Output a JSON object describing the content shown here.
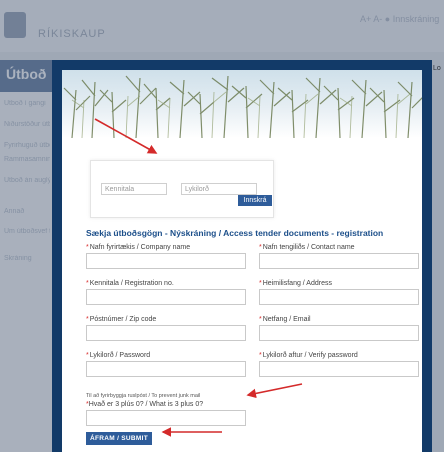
{
  "background": {
    "logo_text": "RÍKISKAUP",
    "sidebar_title": "Útboð",
    "sidebar_items": [
      "Útboð í gangi",
      "Niðurstöður útboða",
      "Fyrirhuguð útboð",
      "Rammasamningar",
      "Útboð án auglýsingar",
      "Annað",
      "Um útboðsvef tender doc...",
      "Skráning"
    ],
    "right_text": "Lo",
    "header_icons": "A+ A- ● Innskráning"
  },
  "login": {
    "id_placeholder": "Kennitala",
    "password_placeholder": "Lykilorð",
    "button_label": "Innskrá"
  },
  "section_title": "Sækja útboðsgögn - Nýskráning / Access tender documents - registration",
  "fields": [
    {
      "label": "Nafn fyrirtækis / Company name"
    },
    {
      "label": "Nafn tengiliðs / Contact name"
    },
    {
      "label": "Kennitala / Registration no."
    },
    {
      "label": "Heimilisfang / Address"
    },
    {
      "label": "Póstnúmer / Zip code"
    },
    {
      "label": "Netfang / Email"
    },
    {
      "label": "Lykilorð / Password"
    },
    {
      "label": "Lykilorð aftur / Verify password"
    }
  ],
  "captcha": {
    "note": "Til að fyrirbyggja ruslpóst / To prevent junk mail",
    "question": "Hvað er 3 plús 0? / What is 3 plus 0?"
  },
  "submit_label": "ÁFRAM / SUBMIT",
  "colors": {
    "modal_frame": "#123a68",
    "accent_button": "#2e5c9a",
    "title_color": "#1c4f8a",
    "annotation_arrow": "#d42a2a"
  }
}
